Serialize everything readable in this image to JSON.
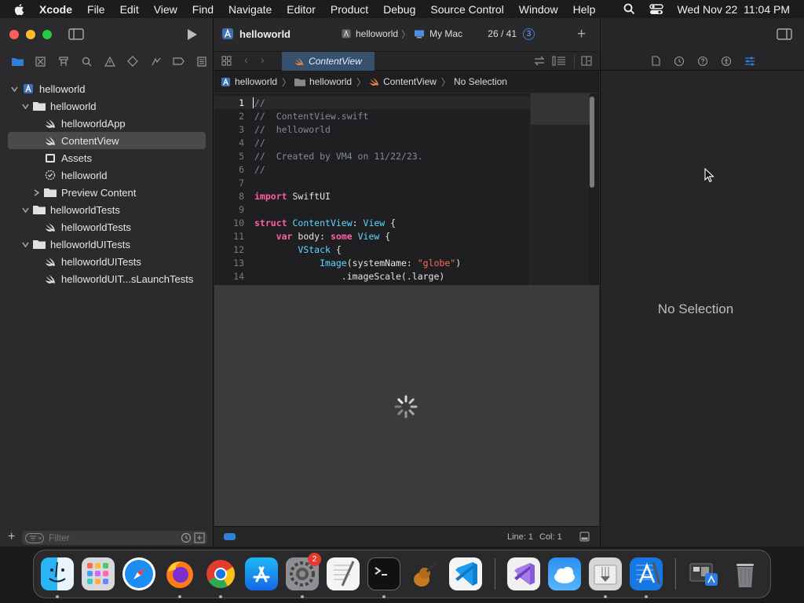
{
  "menubar": {
    "app_name": "Xcode",
    "items": [
      "File",
      "Edit",
      "View",
      "Find",
      "Navigate",
      "Editor",
      "Product",
      "Debug",
      "Source Control",
      "Window",
      "Help"
    ],
    "clock": "Wed Nov 22  11:04 PM"
  },
  "toolbar": {
    "project_title": "helloworld",
    "scheme": "helloworld",
    "destination": "My Mac",
    "build_progress": "26 / 41",
    "issue_count": "3"
  },
  "editor": {
    "tab_label": "ContentView",
    "jump_bar": [
      "helloworld",
      "helloworld",
      "ContentView",
      "No Selection"
    ],
    "code_lines": [
      {
        "n": "1",
        "t": "//"
      },
      {
        "n": "2",
        "t": "//  ContentView.swift"
      },
      {
        "n": "3",
        "t": "//  helloworld"
      },
      {
        "n": "4",
        "t": "//"
      },
      {
        "n": "5",
        "t": "//  Created by VM4 on 11/22/23."
      },
      {
        "n": "6",
        "t": "//"
      },
      {
        "n": "7",
        "t": ""
      },
      {
        "n": "8",
        "t": "import SwiftUI"
      },
      {
        "n": "9",
        "t": ""
      },
      {
        "n": "10",
        "t": "struct ContentView: View {"
      },
      {
        "n": "11",
        "t": "    var body: some View {"
      },
      {
        "n": "12",
        "t": "        VStack {"
      },
      {
        "n": "13",
        "t": "            Image(systemName: \"globe\")"
      },
      {
        "n": "14",
        "t": "                .imageScale(.large)"
      }
    ],
    "status_line": "Line: 1",
    "status_col": "Col: 1"
  },
  "navigator": {
    "tree": [
      {
        "label": "helloworld",
        "icon": "xcode-project-icon",
        "expanded": true
      },
      {
        "label": "helloworld",
        "icon": "folder-icon",
        "expanded": true
      },
      {
        "label": "helloworldApp",
        "icon": "swift-file-icon"
      },
      {
        "label": "ContentView",
        "icon": "swift-file-icon",
        "selected": true
      },
      {
        "label": "Assets",
        "icon": "asset-catalog-icon"
      },
      {
        "label": "helloworld",
        "icon": "entitlements-icon"
      },
      {
        "label": "Preview Content",
        "icon": "folder-icon",
        "expanded": false
      },
      {
        "label": "helloworldTests",
        "icon": "folder-icon",
        "expanded": true
      },
      {
        "label": "helloworldTests",
        "icon": "swift-file-icon"
      },
      {
        "label": "helloworldUITests",
        "icon": "folder-icon",
        "expanded": true
      },
      {
        "label": "helloworldUITests",
        "icon": "swift-file-icon"
      },
      {
        "label": "helloworldUIT...sLaunchTests",
        "icon": "swift-file-icon"
      }
    ],
    "filter_placeholder": "Filter"
  },
  "inspector": {
    "empty_text": "No Selection"
  },
  "dock": {
    "apps": [
      "Finder",
      "Launchpad",
      "Safari",
      "Firefox",
      "Chrome",
      "App Store",
      "System Settings",
      "TextEdit",
      "Terminal",
      "Instruments",
      "Visual Studio Code",
      "Visual Studio",
      "Weather",
      "Archive Utility",
      "Xcode",
      "Screenshot",
      "Trash"
    ],
    "settings_badge": "2"
  },
  "colors": {
    "accent": "#2f7fd6",
    "keyword": "#fc5fa3",
    "type": "#5dd8ff",
    "string": "#fc6a5d",
    "comment": "#7f8c98"
  }
}
